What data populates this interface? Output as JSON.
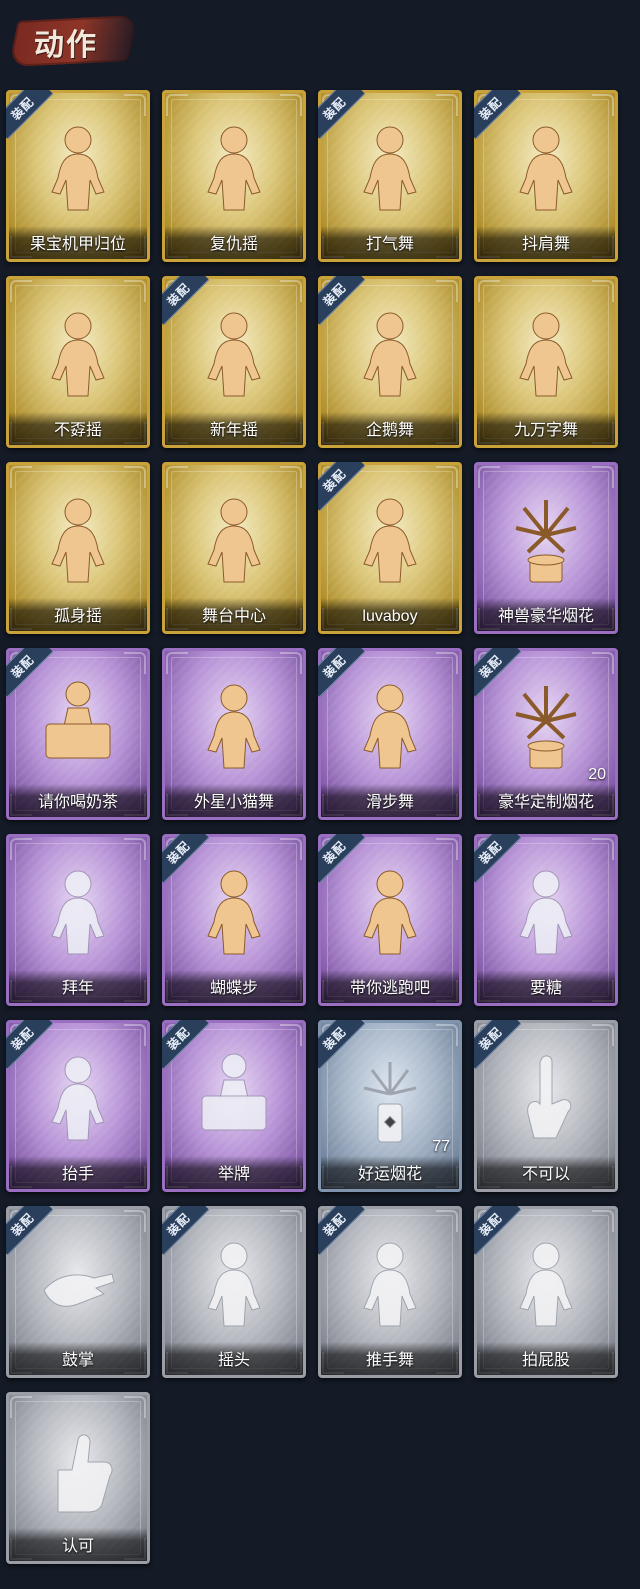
{
  "section_title": "动作",
  "equipped_label": "装配",
  "cards": [
    {
      "name": "果宝机甲归位",
      "rarity": "gold",
      "equipped": true,
      "icon": "dance-figure-icon"
    },
    {
      "name": "复仇摇",
      "rarity": "gold",
      "equipped": false,
      "icon": "dance-figure-icon"
    },
    {
      "name": "打气舞",
      "rarity": "gold",
      "equipped": true,
      "icon": "dance-figure-icon"
    },
    {
      "name": "抖肩舞",
      "rarity": "gold",
      "equipped": true,
      "icon": "dance-figure-icon"
    },
    {
      "name": "不孬摇",
      "rarity": "gold",
      "equipped": false,
      "icon": "dance-figure-icon"
    },
    {
      "name": "新年摇",
      "rarity": "gold",
      "equipped": true,
      "icon": "dance-figure-icon"
    },
    {
      "name": "企鹅舞",
      "rarity": "gold",
      "equipped": true,
      "icon": "dance-figure-icon"
    },
    {
      "name": "九万字舞",
      "rarity": "gold",
      "equipped": false,
      "icon": "dance-figure-icon"
    },
    {
      "name": "孤身摇",
      "rarity": "gold",
      "equipped": false,
      "icon": "dance-figure-icon"
    },
    {
      "name": "舞台中心",
      "rarity": "gold",
      "equipped": false,
      "icon": "dance-figure-icon"
    },
    {
      "name": "luvaboy",
      "rarity": "gold",
      "equipped": true,
      "icon": "dance-figure-icon"
    },
    {
      "name": "神兽豪华烟花",
      "rarity": "purple",
      "equipped": false,
      "icon": "fireworks-icon"
    },
    {
      "name": "请你喝奶茶",
      "rarity": "purple",
      "equipped": true,
      "icon": "sign-figure-icon"
    },
    {
      "name": "外星小猫舞",
      "rarity": "purple",
      "equipped": false,
      "icon": "dance-figure-icon"
    },
    {
      "name": "滑步舞",
      "rarity": "purple",
      "equipped": true,
      "icon": "dance-figure-icon"
    },
    {
      "name": "豪华定制烟花",
      "rarity": "purple",
      "equipped": true,
      "icon": "fireworks-icon",
      "count": "20"
    },
    {
      "name": "拜年",
      "rarity": "purple",
      "equipped": false,
      "icon": "bow-figure-icon",
      "faded": true
    },
    {
      "name": "蝴蝶步",
      "rarity": "purple",
      "equipped": true,
      "icon": "dance-figure-icon"
    },
    {
      "name": "带你逃跑吧",
      "rarity": "purple",
      "equipped": true,
      "icon": "dance-figure-icon"
    },
    {
      "name": "要糖",
      "rarity": "purple",
      "equipped": true,
      "icon": "beg-figure-icon",
      "faded": true
    },
    {
      "name": "抬手",
      "rarity": "purple",
      "equipped": true,
      "icon": "raise-hand-figure-icon",
      "faded": true
    },
    {
      "name": "举牌",
      "rarity": "purple",
      "equipped": true,
      "icon": "sign-figure-icon",
      "faded": true
    },
    {
      "name": "好运烟花",
      "rarity": "blue",
      "equipped": true,
      "icon": "firework-can-icon",
      "count": "77"
    },
    {
      "name": "不可以",
      "rarity": "gray",
      "equipped": true,
      "icon": "finger-wag-icon"
    },
    {
      "name": "鼓掌",
      "rarity": "gray",
      "equipped": true,
      "icon": "clap-hands-icon"
    },
    {
      "name": "摇头",
      "rarity": "gray",
      "equipped": true,
      "icon": "shake-head-figure-icon"
    },
    {
      "name": "推手舞",
      "rarity": "gray",
      "equipped": true,
      "icon": "push-hands-figure-icon"
    },
    {
      "name": "拍屁股",
      "rarity": "gray",
      "equipped": true,
      "icon": "pat-figure-icon"
    },
    {
      "name": "认可",
      "rarity": "gray",
      "equipped": false,
      "icon": "thumbs-up-icon"
    }
  ]
}
